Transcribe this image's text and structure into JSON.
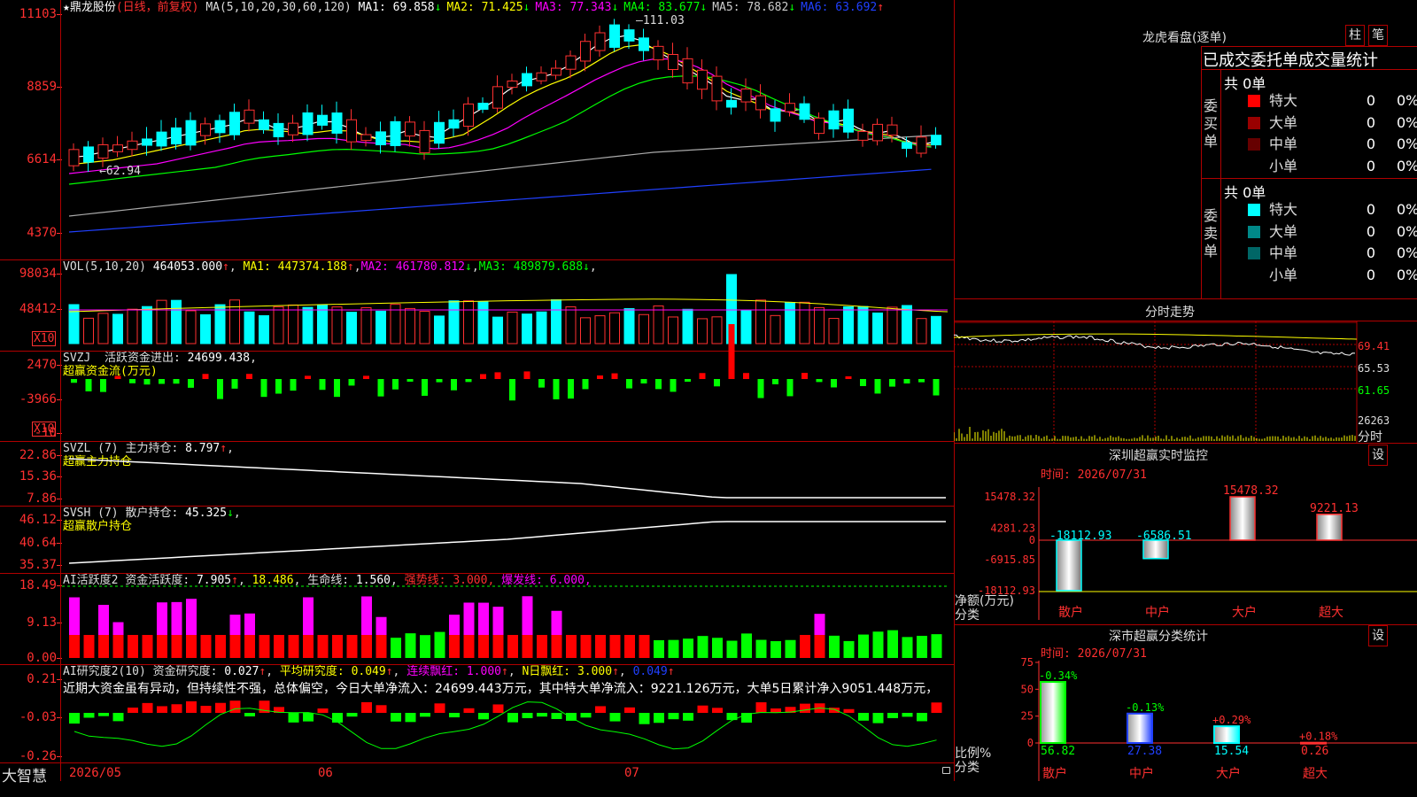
{
  "stock": {
    "star": "★",
    "name": "鼎龙股份",
    "period": "(日线，前复权)",
    "ma_label": "MA(5,10,20,30,60,120)",
    "ma_values": [
      {
        "label": "MA1:",
        "value": "69.858",
        "arrow": "↓",
        "color": "#ffffff"
      },
      {
        "label": "MA2:",
        "value": "71.425",
        "arrow": "↓",
        "color": "#ffff00"
      },
      {
        "label": "MA3:",
        "value": "77.343",
        "arrow": "↓",
        "color": "#ff00ff"
      },
      {
        "label": "MA4:",
        "value": "83.677",
        "arrow": "↓",
        "color": "#00ff00"
      },
      {
        "label": "MA5:",
        "value": "78.682",
        "arrow": "↓",
        "color": "#cccccc"
      },
      {
        "label": "MA6:",
        "value": "63.692",
        "arrow": "↑",
        "color": "#2040ff"
      }
    ],
    "y_ticks": [
      "11103",
      "8859",
      "6614",
      "4370"
    ],
    "high_label": "111.03",
    "low_label": "62.94"
  },
  "volume": {
    "label": "VOL(5,10,20)",
    "value": "464053.000",
    "arrow": "↑",
    "ma": [
      {
        "label": "MA1:",
        "value": "447374.188",
        "arrow": "↑",
        "color": "#ffff00"
      },
      {
        "label": "MA2:",
        "value": "461780.812",
        "arrow": "↓",
        "color": "#ff00ff"
      },
      {
        "label": "MA3:",
        "value": "489879.688",
        "arrow": "↓",
        "color": "#00ff00"
      }
    ],
    "y_ticks": [
      "98034",
      "48412"
    ],
    "unit": "X10"
  },
  "svzj": {
    "label": "SVZJ",
    "name": "活跃资金进出:",
    "value": "24699.438",
    "suffix": ",",
    "subtitle": "超赢资金流(万元)",
    "y_ticks": [
      "2470",
      "-3966",
      "-10"
    ],
    "unit": "X10"
  },
  "svzl": {
    "label": "SVZL (7)",
    "name": "主力持仓:",
    "value": "8.797",
    "arrow": "↑",
    "suffix": ",",
    "subtitle": "超赢主力持仓",
    "y_ticks": [
      "22.86",
      "15.36",
      "7.86"
    ]
  },
  "svsh": {
    "label": "SVSH (7)",
    "name": "散户持仓:",
    "value": "45.325",
    "arrow": "↓",
    "suffix": ",",
    "subtitle": "超赢散户持仓",
    "y_ticks": [
      "46.12",
      "40.64",
      "35.37"
    ]
  },
  "ai_active": {
    "label": "AI活跃度2",
    "name": "资金活跃度:",
    "value": "7.905",
    "arrow": "↑",
    "v2": "18.486",
    "life_label": "生命线:",
    "life": "1.560",
    "strong_label": "强势线:",
    "strong": "3.000",
    "burst_label": "爆发线:",
    "burst": "6.000",
    "y_ticks": [
      "18.49",
      "9.13",
      "0.00"
    ]
  },
  "ai_research": {
    "label": "AI研究度2(10)",
    "name": "资金研究度:",
    "value": "0.027",
    "arrow": "↑",
    "avg_label": "平均研究度:",
    "avg": "0.049",
    "red_label": "连续飘红:",
    "red": "1.000",
    "nday_label": "N日飘红:",
    "nday": "3.000",
    "last": "0.049",
    "comment": "近期大资金虽有异动，但持续性不强，总体偏空，今日大单净流入：24699.443万元，其中特大单净流入：9221.126万元，大单5日累计净入9051.448万元，",
    "y_ticks": [
      "0.21",
      "-0.03",
      "-0.26"
    ]
  },
  "x_axis": {
    "brand": "大智慧",
    "labels": [
      "2026/05",
      "06",
      "07"
    ]
  },
  "lhb": {
    "title": "龙虎看盘(逐单)",
    "btn1": "柱",
    "btn2": "笔",
    "header": "已成交委托单成交量统计",
    "buy_label": "委买单",
    "sell_label": "委卖单",
    "buy_total": "共 0单",
    "sell_total": "共 0单",
    "buy_rows": [
      {
        "label": "特大",
        "count": "0",
        "pct": "0%",
        "color": "#ff0000"
      },
      {
        "label": "大单",
        "count": "0",
        "pct": "0%",
        "color": "#990000"
      },
      {
        "label": "中单",
        "count": "0",
        "pct": "0%",
        "color": "#660000"
      },
      {
        "label": "小单",
        "count": "0",
        "pct": "0%",
        "color": "#000000"
      }
    ],
    "sell_rows": [
      {
        "label": "特大",
        "count": "0",
        "pct": "0%",
        "color": "#00ffff"
      },
      {
        "label": "大单",
        "count": "0",
        "pct": "0%",
        "color": "#008888"
      },
      {
        "label": "中单",
        "count": "0",
        "pct": "0%",
        "color": "#006666"
      },
      {
        "label": "小单",
        "count": "0",
        "pct": "0%",
        "color": "#000000"
      }
    ]
  },
  "intraday": {
    "title": "分时走势",
    "y_ticks": [
      "69.41",
      "65.53",
      "61.65",
      "26263"
    ],
    "footer": "分时"
  },
  "monitor": {
    "title": "深圳超赢实时监控",
    "btn": "设",
    "time": "时间: 2026/07/31",
    "y_ticks": [
      "15478.32",
      "4281.23",
      "0",
      "-6915.85",
      "-18112.93"
    ],
    "y_label": "净额(万元)",
    "x_label": "分类",
    "bars": [
      {
        "label": "散户",
        "value": -18112.93,
        "text": "-18112.93"
      },
      {
        "label": "中户",
        "value": -6586.51,
        "text": "-6586.51"
      },
      {
        "label": "大户",
        "value": 15478.32,
        "text": "15478.32"
      },
      {
        "label": "超大",
        "value": 9221.13,
        "text": "9221.13"
      }
    ]
  },
  "classify": {
    "title": "深市超赢分类统计",
    "btn": "设",
    "time": "时间: 2026/07/31",
    "y_ticks": [
      "75",
      "50",
      "25",
      "0"
    ],
    "y_label": "比例%",
    "x_label": "分类",
    "bars": [
      {
        "label": "散户",
        "value": 56.82,
        "text": "56.82",
        "change": "-0.34%",
        "color": "#00ff00"
      },
      {
        "label": "中户",
        "value": 27.38,
        "text": "27.38",
        "change": "-0.13%",
        "color": "#2040ff"
      },
      {
        "label": "大户",
        "value": 15.54,
        "text": "15.54",
        "change": "+0.29%",
        "color": "#00ffff"
      },
      {
        "label": "超大",
        "value": 0.26,
        "text": "0.26",
        "change": "+0.18%",
        "color": "#ff3030"
      }
    ]
  }
}
